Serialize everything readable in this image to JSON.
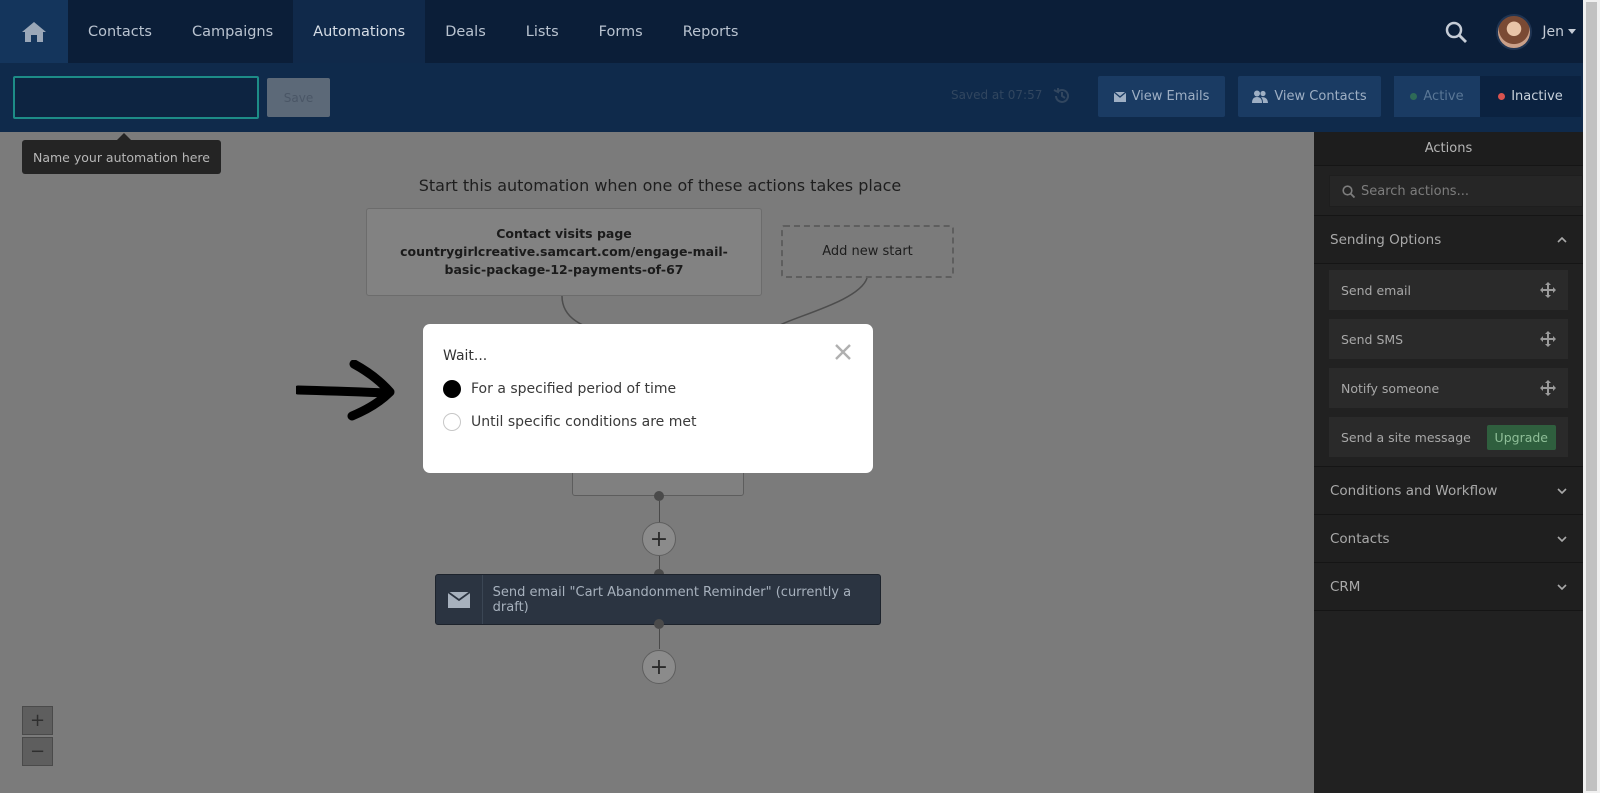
{
  "nav": {
    "items": [
      "Contacts",
      "Campaigns",
      "Automations",
      "Deals",
      "Lists",
      "Forms",
      "Reports"
    ],
    "active_index": 2,
    "user_name": "Jen"
  },
  "toolbar": {
    "name_input_value": "",
    "save_label": "Save",
    "saved_at": "Saved at 07:57",
    "view_emails_label": "View Emails",
    "view_contacts_label": "View Contacts",
    "active_label": "Active",
    "inactive_label": "Inactive"
  },
  "tooltip": "Name your automation here",
  "canvas": {
    "start_heading": "Start this automation when one of these actions takes place",
    "trigger_title": "Contact visits page",
    "trigger_url": "countrygirlcreative.samcart.com/engage-mail-basic-package-12-payments-of-67",
    "add_new_start": "Add new start",
    "email_step_label": "Send email \"Cart Abandonment Reminder\" (currently a draft)"
  },
  "modal": {
    "title": "Wait...",
    "options": [
      {
        "label": "For a specified period of time",
        "checked": true
      },
      {
        "label": "Until specific conditions are met",
        "checked": false
      }
    ]
  },
  "panel": {
    "title": "Actions",
    "search_placeholder": "Search actions...",
    "sections": {
      "sending_options": "Sending Options",
      "conditions": "Conditions and Workflow",
      "contacts": "Contacts",
      "crm": "CRM"
    },
    "actions": {
      "send_email": "Send email",
      "send_sms": "Send SMS",
      "notify_someone": "Notify someone",
      "send_site_message": "Send a site message",
      "upgrade": "Upgrade"
    }
  },
  "colors": {
    "nav_bg": "#0b1e38",
    "toolbar_bg": "#0f2a4b",
    "input_border": "#1d8c87",
    "inactive_dot": "#d9534f",
    "active_dot": "#2e6a57"
  }
}
